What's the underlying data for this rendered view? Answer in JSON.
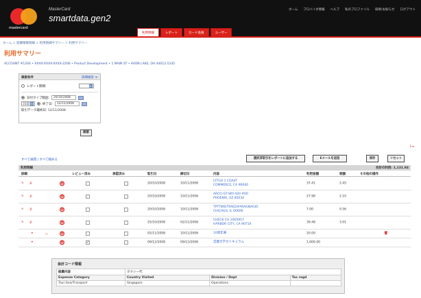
{
  "header": {
    "brand_small": "MasterCard",
    "brand_name": "smartdata.gen2",
    "logo_text": "mastercard",
    "top_links": [
      "ホーム",
      "プロバイダ情報",
      "ヘルプ",
      "私のプロファイル",
      "研修/お知らせ",
      "ログアウト"
    ],
    "tabs": [
      {
        "label": "利用明細",
        "active": true
      },
      {
        "label": "レポート",
        "active": false
      },
      {
        "label": "カード会員",
        "active": false
      },
      {
        "label": "ユーザー",
        "active": false
      }
    ]
  },
  "breadcrumb": "ホーム > 経費精算明細 > 利用明細サマリー > 利用サマリー",
  "page_title": "利用サマリー",
  "account_line": "ACCOUNT #1204 • XXXX-XXXX-XXXX-2206 • Product Development • 1 MAIN ST • AVON LAKE, OH 44012-5145",
  "search_panel": {
    "title": "検索条件",
    "advanced_label": "詳細検索 ≫",
    "report_label": "レポート期間:",
    "date_range_label": "日付タイプ範囲:",
    "date_start": "20/10/2008",
    "days_label": "31日",
    "to_label": "終了日:",
    "date_end": "12/11/2008",
    "last_date_label": "取引データ最終日: 12/11/2008",
    "search_button": "検索"
  },
  "pager": "1 ▸",
  "expand_links": "すべて展開 | すべて縮める",
  "buttons": {
    "add_report": "選択済取引をレポートに追加する",
    "email_send": "Eメールを送信",
    "save": "保存",
    "reset": "リセット"
  },
  "table": {
    "title": "利用明細",
    "total": "合計の利用: 1,131.84",
    "columns": [
      "詳細",
      "レビュー済み",
      "承認済み",
      "取引日",
      "締切日",
      "内容",
      "利用金額",
      "税額",
      "その他の操作"
    ],
    "rows": [
      {
        "date": "20/10/2008",
        "post": "10/11/2008",
        "merchant": [
          "CITGO 1 COAST",
          "COMMERCE, CA 90040"
        ],
        "amount": "37.41",
        "tax": "2.45",
        "reviewed": false,
        "approved": false,
        "type": "txn"
      },
      {
        "date": "20/10/2008",
        "post": "10/11/2008",
        "merchant": [
          "ARCO-GT-SKY-420 #00",
          "PHOENIX, AZ 85034"
        ],
        "amount": "27.98",
        "tax": "2.10",
        "reviewed": false,
        "approved": false,
        "type": "txn"
      },
      {
        "date": "20/10/2008",
        "post": "10/11/2008",
        "merchant": [
          "TPTTWEITRAED#ARAGNAGIO",
          "CHICAGO, IL 60606"
        ],
        "amount": "7.00",
        "tax": "0.56",
        "reviewed": false,
        "approved": false,
        "type": "txn"
      },
      {
        "date": "25/10/2008",
        "post": "02/11/2008",
        "merchant": [
          "CHECK CH 2005957",
          "HARBOR CITY, CA 90710"
        ],
        "amount": "39.48",
        "tax": "3.01",
        "reviewed": false,
        "approved": false,
        "type": "txn"
      },
      {
        "date": "02/11/2008",
        "post": "10/11/2008",
        "merchant": [
          "10周年車"
        ],
        "amount": "20.00",
        "tax": "",
        "reviewed": false,
        "approved": false,
        "type": "short"
      },
      {
        "date": "09/12/2008",
        "post": "09/12/2008",
        "merchant": [
          "営業大学カリキュラム"
        ],
        "amount": "1,000.00",
        "tax": "",
        "reviewed": true,
        "approved": false,
        "type": "short"
      }
    ]
  },
  "detail": {
    "title": "会計コード情報",
    "row1_label": "経費内容",
    "row1_value": "タクシー代",
    "headers": [
      "Expense Category",
      "Country Visited",
      "Division / Dept",
      "Tax regd"
    ],
    "values": [
      "Taxi fare/Transport",
      "Singapore",
      "Operations",
      ""
    ]
  },
  "colors": {
    "brand_red": "#d8221a",
    "title_orange": "#e56b2b",
    "link_blue": "#3366cc"
  }
}
